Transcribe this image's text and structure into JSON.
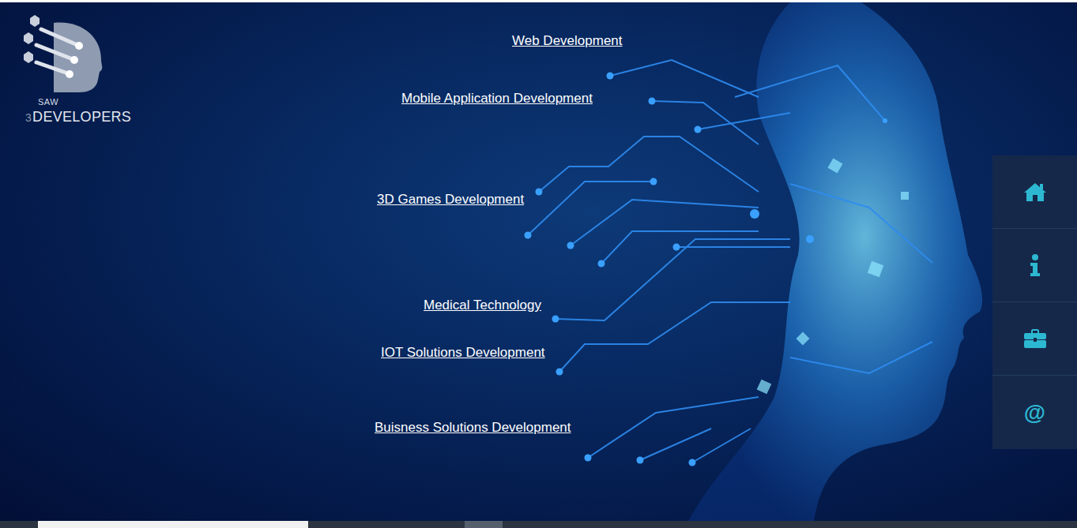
{
  "logo": {
    "top": "SAW",
    "mark": "3",
    "bottom": "DEVELOPERS"
  },
  "links": [
    {
      "label": "Web Development"
    },
    {
      "label": "Mobile Application Development"
    },
    {
      "label": "3D Games Development"
    },
    {
      "label": "Medical Technology"
    },
    {
      "label": "IOT Solutions Development"
    },
    {
      "label": "Buisness Solutions Development"
    }
  ],
  "side_nav": {
    "contact_glyph": "@"
  }
}
